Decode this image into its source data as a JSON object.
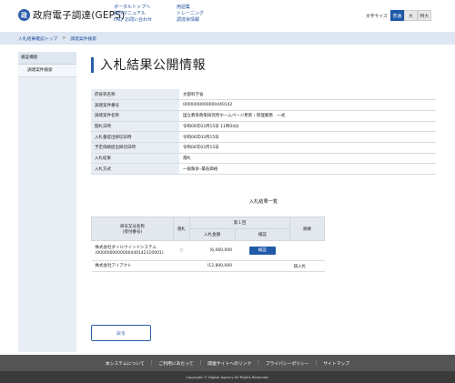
{
  "header": {
    "logo_mark": "政",
    "logo_text": "政府電子調達(GEPS)",
    "links_col1": [
      "ポータルトップへ",
      "操作マニュアル",
      "FAQ･お問い合わせ"
    ],
    "links_col2": [
      "用語集",
      "トレーニング",
      "調達余情報"
    ],
    "font_size_label": "文字サイズ",
    "font_size_options": [
      "普通",
      "大",
      "特大"
    ],
    "font_size_selected": "普通"
  },
  "breadcrumb": [
    "入札結果確認トップ",
    "調達案件検索"
  ],
  "sidebar": {
    "heading": "検証機能",
    "items": [
      "調達案件検索"
    ]
  },
  "page_title": "入札結果公開情報",
  "info_rows": [
    {
      "label": "府省等名称",
      "value": "文部科学省"
    },
    {
      "label": "調達案件番号",
      "value": "0000000000000440142"
    },
    {
      "label": "調達案件名称",
      "value": "国立教育政策研究所ホームページ更新・管理業務　一式"
    },
    {
      "label": "開札日時",
      "value": "令和06年03月15日 11時04分"
    },
    {
      "label": "入札書提出締切日時",
      "value": "令和06年03月15日"
    },
    {
      "label": "予定価格提出締切日時",
      "value": "令和06年03月15日"
    },
    {
      "label": "入札結果",
      "value": "落札"
    },
    {
      "label": "入札方式",
      "value": "一般競争･最低価格"
    }
  ],
  "results": {
    "title": "入札結果一覧",
    "headers": {
      "company": "商号又は名称",
      "company_sub": "(受付番号)",
      "award": "落札",
      "round": "第１回",
      "amount": "入札金額",
      "verify": "検証",
      "remarks": "摘要"
    },
    "rows": [
      {
        "name": "株式会社ダイルウインドシステム",
        "number": "(0000000000000440142310001)",
        "award": "○",
        "amount": "\\6,060,000",
        "verify": "検証",
        "remarks": ""
      },
      {
        "name": "株式会社アイアクト",
        "number": "",
        "award": "",
        "amount": "\\12,800,000",
        "verify": "",
        "remarks": "辞入札"
      }
    ]
  },
  "back_button": "戻る",
  "footer": {
    "links": [
      "本システムについて",
      "ご利用にあたって",
      "関連サイトへのリンク",
      "プライバシーポリシー",
      "サイトマップ"
    ],
    "copyright": "Copyright © Digital Agency All Rights Reserved."
  }
}
